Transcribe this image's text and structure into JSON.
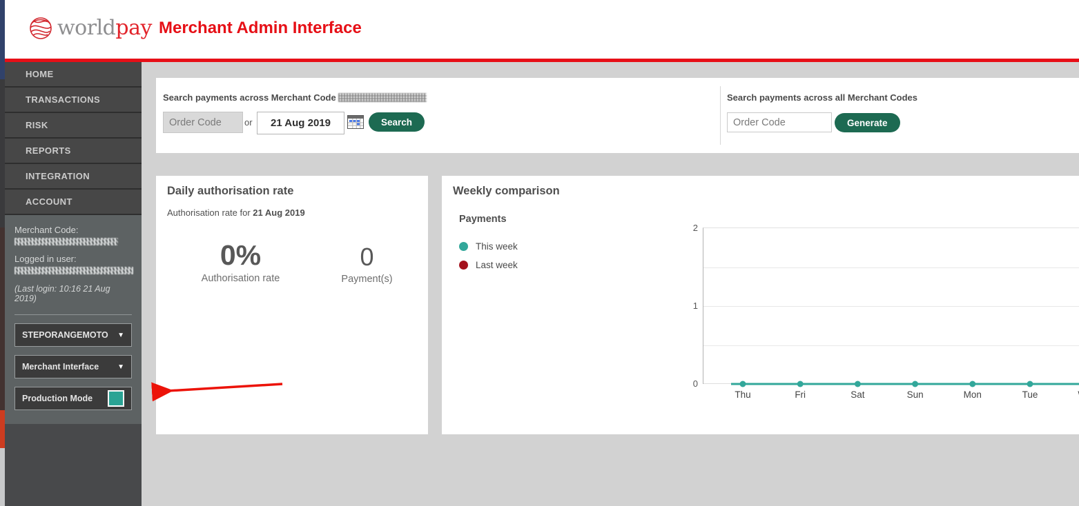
{
  "header": {
    "logo_world": "world",
    "logo_pay": "pay",
    "title": "Merchant Admin Interface"
  },
  "sidebar": {
    "nav_items": [
      {
        "label": "HOME"
      },
      {
        "label": "TRANSACTIONS"
      },
      {
        "label": "RISK"
      },
      {
        "label": "REPORTS"
      },
      {
        "label": "INTEGRATION"
      },
      {
        "label": "ACCOUNT"
      }
    ],
    "merchant_code_label": "Merchant Code:",
    "logged_in_user_label": "Logged in user:",
    "last_login": "(Last login: 10:16 21 Aug 2019)",
    "merchant_dropdown_value": "STEPORANGEMOTO",
    "interface_dropdown_value": "Merchant Interface",
    "production_mode_label": "Production Mode"
  },
  "search_panel": {
    "merchant_search": {
      "label": "Search payments across Merchant Code",
      "order_code_placeholder": "Order Code",
      "or_label": "or",
      "date_value": "21 Aug 2019",
      "search_button": "Search"
    },
    "all_merchants_search": {
      "label": "Search payments across all Merchant Codes",
      "order_code_placeholder": "Order Code",
      "generate_button": "Generate"
    }
  },
  "daily_auth_card": {
    "title": "Daily authorisation rate",
    "subtitle_prefix": "Authorisation rate for ",
    "subtitle_date": "21 Aug 2019",
    "rate_value": "0%",
    "rate_label": "Authorisation rate",
    "payments_value": "0",
    "payments_label": "Payment(s)"
  },
  "weekly_card": {
    "title": "Weekly comparison",
    "legend": [
      {
        "label": "This week",
        "color": "#32a79a"
      },
      {
        "label": "Last week",
        "color": "#a4121d"
      }
    ]
  },
  "chart_data": {
    "type": "line",
    "title": "Payments",
    "categories": [
      "Thu",
      "Fri",
      "Sat",
      "Sun",
      "Mon",
      "Tue",
      "Wed"
    ],
    "series": [
      {
        "name": "This week",
        "color": "#32a79a",
        "values": [
          0,
          0,
          0,
          0,
          0,
          0,
          0
        ]
      },
      {
        "name": "Last week",
        "color": "#a4121d",
        "values": [
          0,
          0,
          0,
          0,
          0,
          0,
          0
        ]
      }
    ],
    "xlabel": "",
    "ylabel": "",
    "ylim": [
      0,
      2
    ],
    "yticks": [
      0,
      1,
      2
    ],
    "gridlines": [
      0.5,
      1,
      1.5
    ],
    "grid": true,
    "legend_position": "left"
  },
  "colors": {
    "brand_red": "#e60f16",
    "button_green": "#1d6a52",
    "teal_accent": "#2aa394",
    "sidebar_dark": "#474747",
    "sidebar_info": "#5d6263",
    "annotation_arrow": "#ec1309"
  }
}
